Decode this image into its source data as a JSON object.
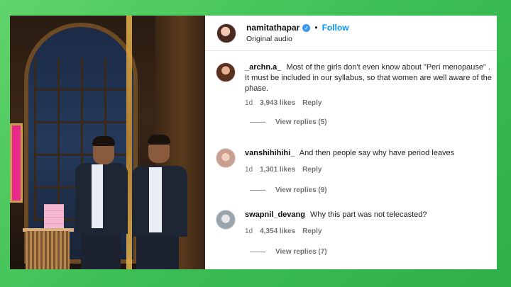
{
  "post": {
    "username": "namitathapar",
    "follow_label": "Follow",
    "audio": "Original audio",
    "separator": "•"
  },
  "comments": [
    {
      "username": "_archn.a_",
      "text": "Most of the girls don't even know about \"Peri menopause\" . It must be included in our syllabus, so that women are well aware of the phase.",
      "age": "1d",
      "likes": "3,943 likes",
      "reply_label": "Reply",
      "view_replies": "View replies (5)"
    },
    {
      "username": "vanshihihihi_",
      "text": "And then people say why have period leaves",
      "age": "1d",
      "likes": "1,301 likes",
      "reply_label": "Reply",
      "view_replies": "View replies (9)"
    },
    {
      "username": "swapnil_devang",
      "text": "Why this part was not telecasted?",
      "age": "1d",
      "likes": "4,354 likes",
      "reply_label": "Reply",
      "view_replies": "View replies (7)"
    }
  ],
  "colors": {
    "background": "#3cbf55",
    "follow": "#0095f6",
    "verified": "#3897f0",
    "meta_text": "#737373"
  },
  "icons": [
    "verified-badge-icon"
  ]
}
